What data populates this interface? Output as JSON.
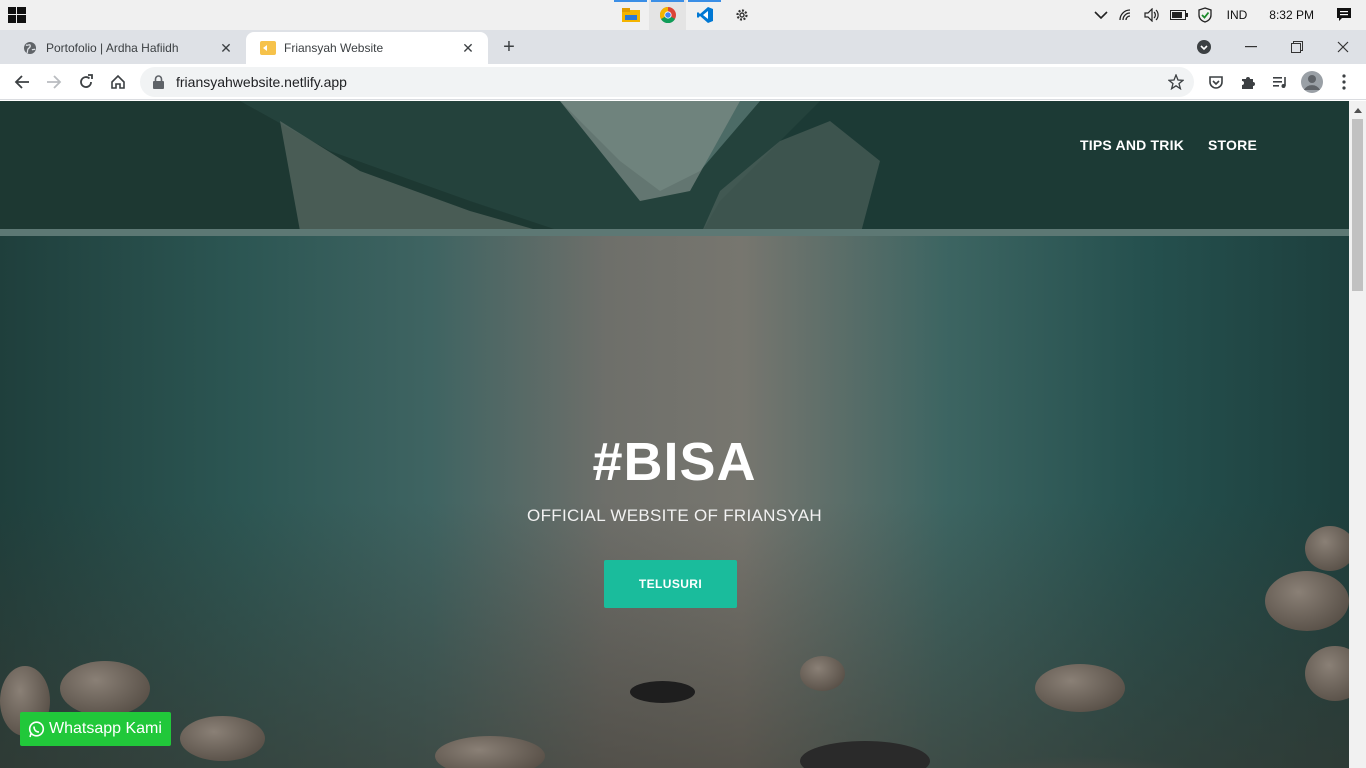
{
  "taskbar": {
    "apps": [
      {
        "name": "file-explorer-icon",
        "color": "#f4b400"
      },
      {
        "name": "chrome-icon",
        "color": "#db4437"
      },
      {
        "name": "vscode-icon",
        "color": "#0078d4"
      },
      {
        "name": "settings-icon",
        "color": "#333333"
      }
    ],
    "language": "IND",
    "time": "8:32 PM"
  },
  "browser": {
    "tabs": [
      {
        "title": "Portofolio | Ardha Hafiidh",
        "active": false
      },
      {
        "title": "Friansyah Website",
        "active": true
      }
    ],
    "url": "friansyahwebsite.netlify.app"
  },
  "site": {
    "nav": [
      "TIPS AND TRIK",
      "STORE"
    ],
    "hero_title": "#BISA",
    "hero_subtitle": "OFFICIAL WEBSITE OF FRIANSYAH",
    "cta_label": "TELUSURI",
    "whatsapp_label": "Whatsapp Kami",
    "accent": "#1abc9c",
    "whatsapp_color": "#21c83a"
  }
}
